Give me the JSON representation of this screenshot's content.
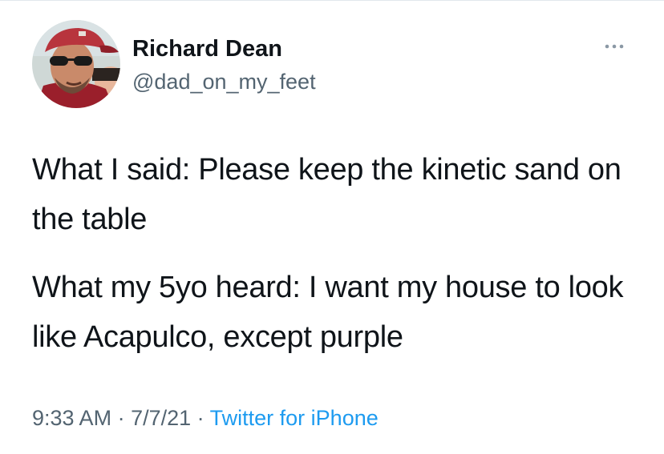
{
  "tweet": {
    "author": {
      "name": "Richard Dean",
      "handle": "@dad_on_my_feet",
      "avatar_icon": "profile-photo"
    },
    "more_icon": "more-options-ellipsis-icon",
    "text": {
      "paragraph_1": "What I said: Please keep the kinetic sand on the table",
      "paragraph_2": "What my 5yo heard: I want my house to look like Acapulco, except purple"
    },
    "meta": {
      "time": "9:33 AM",
      "separator_1": " · ",
      "date": "7/7/21",
      "separator_2": " · ",
      "source": "Twitter for iPhone"
    }
  },
  "colors": {
    "text_primary": "#0f1419",
    "text_secondary": "#536471",
    "link": "#1d9bf0",
    "divider": "#e1e8ed"
  }
}
